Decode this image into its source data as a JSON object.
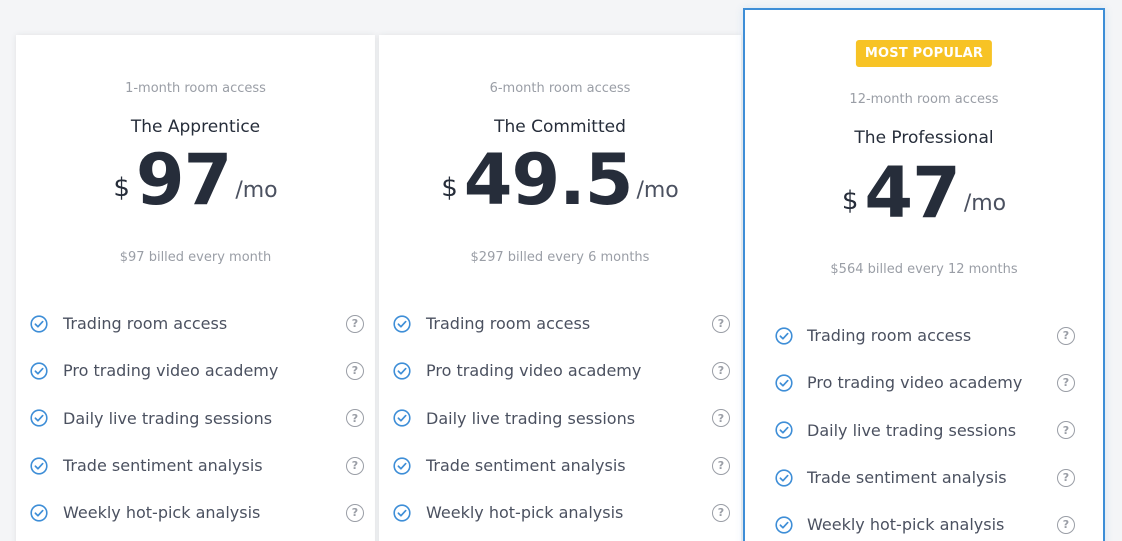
{
  "colors": {
    "accent": "#3e8ed7",
    "badge": "#f7c325",
    "text_dark": "#262d3a",
    "text_muted": "#9a9ea6"
  },
  "plans": [
    {
      "access": "1-month room access",
      "name": "The Apprentice",
      "currency": "$",
      "amount": "97",
      "per": "/mo",
      "billed": "$97 billed every month",
      "features": [
        {
          "label": "Trading room access",
          "help": "?"
        },
        {
          "label": "Pro trading video academy",
          "help": "?"
        },
        {
          "label": "Daily live trading sessions",
          "help": "?"
        },
        {
          "label": "Trade sentiment analysis",
          "help": "?"
        },
        {
          "label": "Weekly hot-pick analysis",
          "help": "?"
        }
      ]
    },
    {
      "access": "6-month room access",
      "name": "The Committed",
      "currency": "$",
      "amount": "49.5",
      "per": "/mo",
      "billed": "$297 billed every 6 months",
      "features": [
        {
          "label": "Trading room access",
          "help": "?"
        },
        {
          "label": "Pro trading video academy",
          "help": "?"
        },
        {
          "label": "Daily live trading sessions",
          "help": "?"
        },
        {
          "label": "Trade sentiment analysis",
          "help": "?"
        },
        {
          "label": "Weekly hot-pick analysis",
          "help": "?"
        }
      ]
    },
    {
      "badge": "MOST POPULAR",
      "access": "12-month room access",
      "name": "The Professional",
      "currency": "$",
      "amount": "47",
      "per": "/mo",
      "billed": "$564 billed every 12 months",
      "features": [
        {
          "label": "Trading room access",
          "help": "?"
        },
        {
          "label": "Pro trading video academy",
          "help": "?"
        },
        {
          "label": "Daily live trading sessions",
          "help": "?"
        },
        {
          "label": "Trade sentiment analysis",
          "help": "?"
        },
        {
          "label": "Weekly hot-pick analysis",
          "help": "?"
        }
      ]
    }
  ],
  "icons": {
    "feature": "check-circle-icon",
    "info": "question-circle-icon"
  }
}
